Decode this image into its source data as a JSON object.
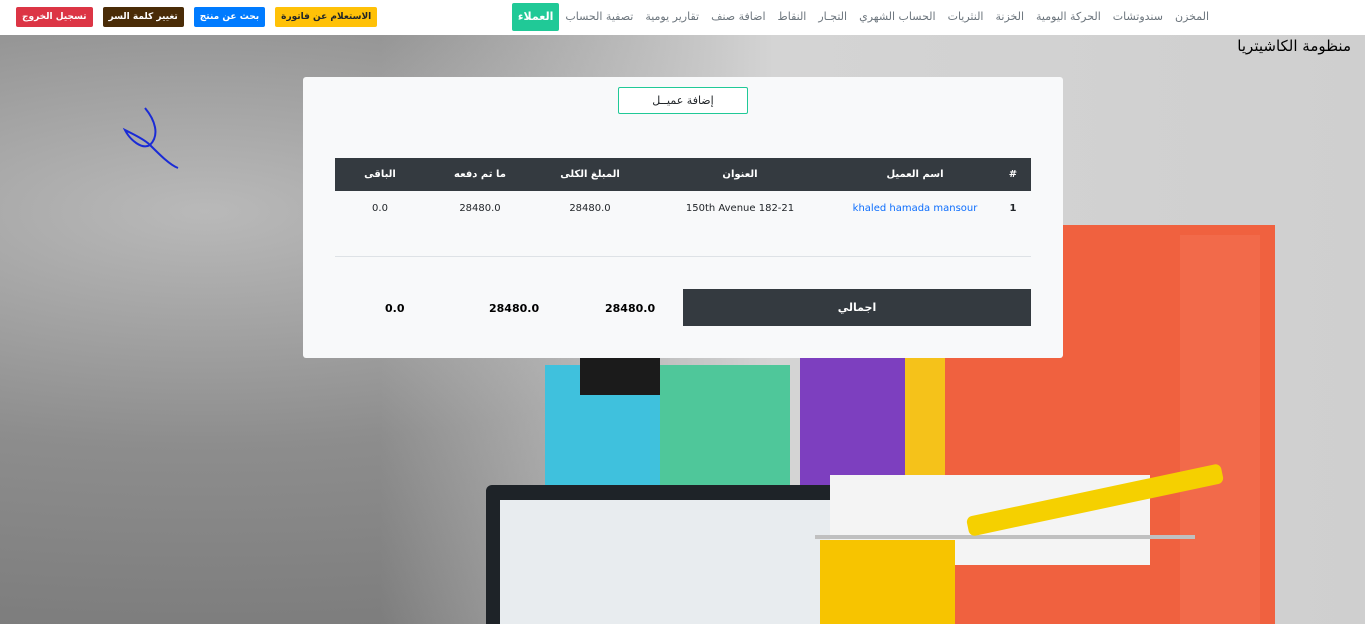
{
  "nav": {
    "links": [
      "المخزن",
      "سندوتشات",
      "الحركة اليومية",
      "الخزنة",
      "النثريات",
      "الحساب الشهري",
      "التجـار",
      "النقاط",
      "اضافة صنف",
      "تقارير يومية",
      "تصفية الحساب"
    ],
    "active": "العملاء"
  },
  "buttons": {
    "logout": "تسجيل الخروج",
    "change_password": "تغيير كلمة السر",
    "search_product": "بحث عن منتج",
    "invoice_query": "الاستعلام عن فاتورة"
  },
  "site_title": "منظومة الكاشيتريا",
  "card": {
    "add_client": "إضافة عميــل",
    "columns": [
      "#",
      "اسم العميل",
      "العنوان",
      "المبلغ الكلى",
      "ما تم دفعه",
      "الباقى"
    ],
    "rows": [
      {
        "num": "1",
        "name": "khaled hamada mansour",
        "address": "150th Avenue 182-21",
        "total": "28480.0",
        "paid": "28480.0",
        "remaining": "0.0"
      }
    ],
    "totals": {
      "label": "اجمالي",
      "total": "28480.0",
      "paid": "28480.0",
      "remaining": "0.0"
    }
  },
  "colors": {
    "accent": "#20c997",
    "dark": "#343a40",
    "link": "#0d6efd"
  }
}
